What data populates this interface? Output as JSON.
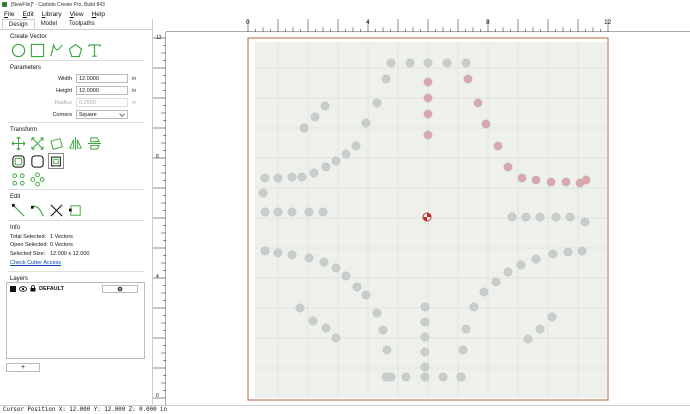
{
  "window": {
    "title": "[NewFile]* - Carbide Create Pro, Build 843"
  },
  "menu": [
    "File",
    "Edit",
    "Library",
    "View",
    "Help"
  ],
  "tabs": [
    "Design",
    "Model",
    "Toolpaths"
  ],
  "create_vector": {
    "title": "Create Vector",
    "icons": [
      "circle-icon",
      "rectangle-icon",
      "curve-icon",
      "polygon-icon",
      "text-icon"
    ]
  },
  "parameters": {
    "title": "Parameters",
    "width_label": "Width",
    "width_value": "12.0000",
    "width_unit": "in",
    "height_label": "Height",
    "height_value": "12.0000",
    "height_unit": "in",
    "radius_label": "Radius",
    "radius_value": "0.2500",
    "radius_unit": "in",
    "corners_label": "Corners",
    "corners_value": "Square"
  },
  "transform": {
    "title": "Transform"
  },
  "edit": {
    "title": "Edit"
  },
  "info": {
    "title": "Info",
    "total_selected_label": "Total Selected:",
    "total_selected_value": "1 Vectors",
    "open_selected_label": "Open Selected:",
    "open_selected_value": "0 Vectors",
    "selected_size_label": "Selected Size:",
    "selected_size_value": "12.000 x 12.000",
    "check_cutter_link": "Check Cutter Access"
  },
  "layers": {
    "title": "Layers",
    "items": [
      {
        "name": "DEFAULT",
        "color": "#111111"
      }
    ],
    "add_label": "+"
  },
  "ruler_top": [
    "0",
    "4",
    "8",
    "12"
  ],
  "ruler_left": [
    "12",
    "8",
    "4",
    "0"
  ],
  "status": {
    "text": "Cursor Position X: 12.000 Y: 12.000 Z: 0.000 in"
  },
  "colors": {
    "accent": "#3aa53a",
    "stock_border": "#c08060",
    "paper": "#eef0ec",
    "hole_grey": "#c9cdcb",
    "hole_red": "#d9a8ae"
  }
}
